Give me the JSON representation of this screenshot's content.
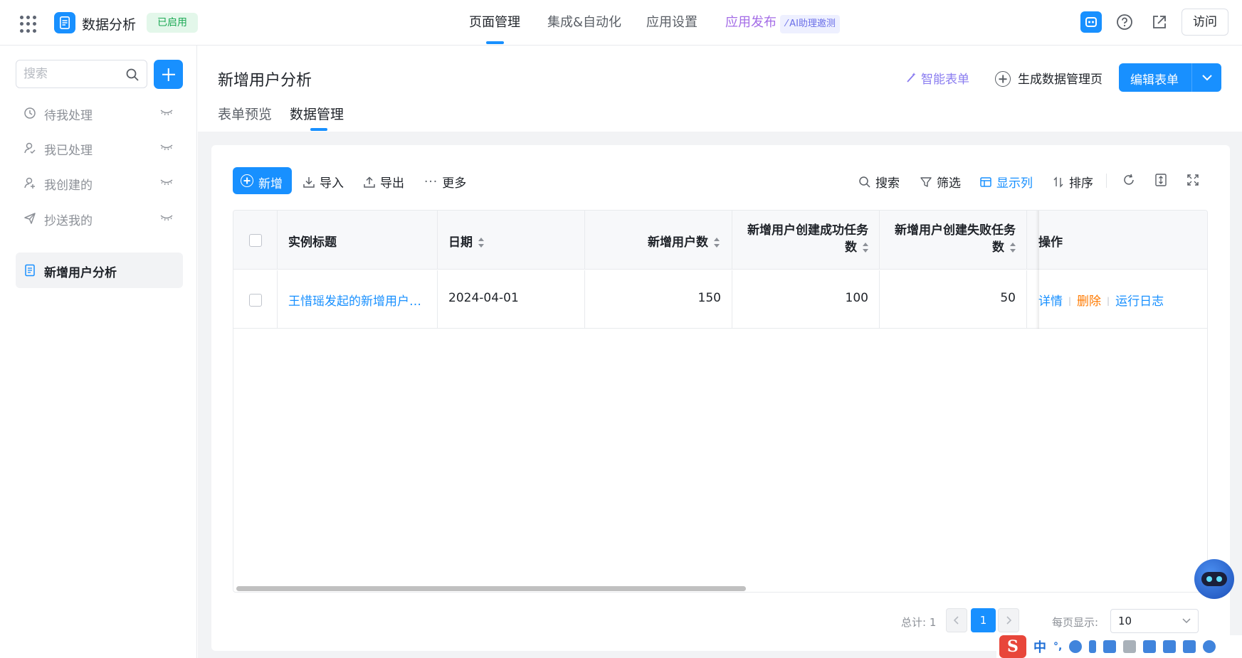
{
  "app": {
    "name": "数据分析",
    "status": "已启用"
  },
  "nav": {
    "items": [
      "页面管理",
      "集成&自动化",
      "应用设置",
      "应用发布"
    ],
    "ai_badge": "AI助理邀测",
    "visit": "访问"
  },
  "sidebar": {
    "search_placeholder": "搜索",
    "items": [
      {
        "label": "待我处理",
        "icon": "clock-icon"
      },
      {
        "label": "我已处理",
        "icon": "user-check-icon"
      },
      {
        "label": "我创建的",
        "icon": "user-add-icon"
      },
      {
        "label": "抄送我的",
        "icon": "send-icon"
      },
      {
        "label": "新增用户分析",
        "icon": "document-icon"
      }
    ]
  },
  "page": {
    "title": "新增用户分析",
    "smart_form": "智能表单",
    "generate_page": "生成数据管理页",
    "edit_form": "编辑表单",
    "tabs": [
      "表单预览",
      "数据管理"
    ]
  },
  "toolbar": {
    "new": "新增",
    "import": "导入",
    "export": "导出",
    "more": "更多",
    "search": "搜索",
    "filter": "筛选",
    "columns": "显示列",
    "sort": "排序"
  },
  "table": {
    "headers": {
      "title": "实例标题",
      "date": "日期",
      "new_users": "新增用户数",
      "success_line1": "新增用户创建成功任务",
      "success_line2": "数",
      "fail_line1": "新增用户创建失败任务",
      "fail_line2": "数",
      "ops": "操作"
    },
    "rows": [
      {
        "title": "王惜瑶发起的新增用户…",
        "date": "2024-04-01",
        "new_users": "150",
        "success": "100",
        "fail": "50",
        "op_detail": "详情",
        "op_delete": "删除",
        "op_log": "运行日志"
      }
    ]
  },
  "pagination": {
    "total": "总计: 1",
    "current_page": "1",
    "page_size_label": "每页显示:",
    "page_size": "10"
  },
  "ime": {
    "logo": "S",
    "lang": "中"
  },
  "colors": {
    "accent": "#1890ff",
    "success": "#1eaa56",
    "warning": "#ff7a00",
    "purple": "#a46de7"
  }
}
